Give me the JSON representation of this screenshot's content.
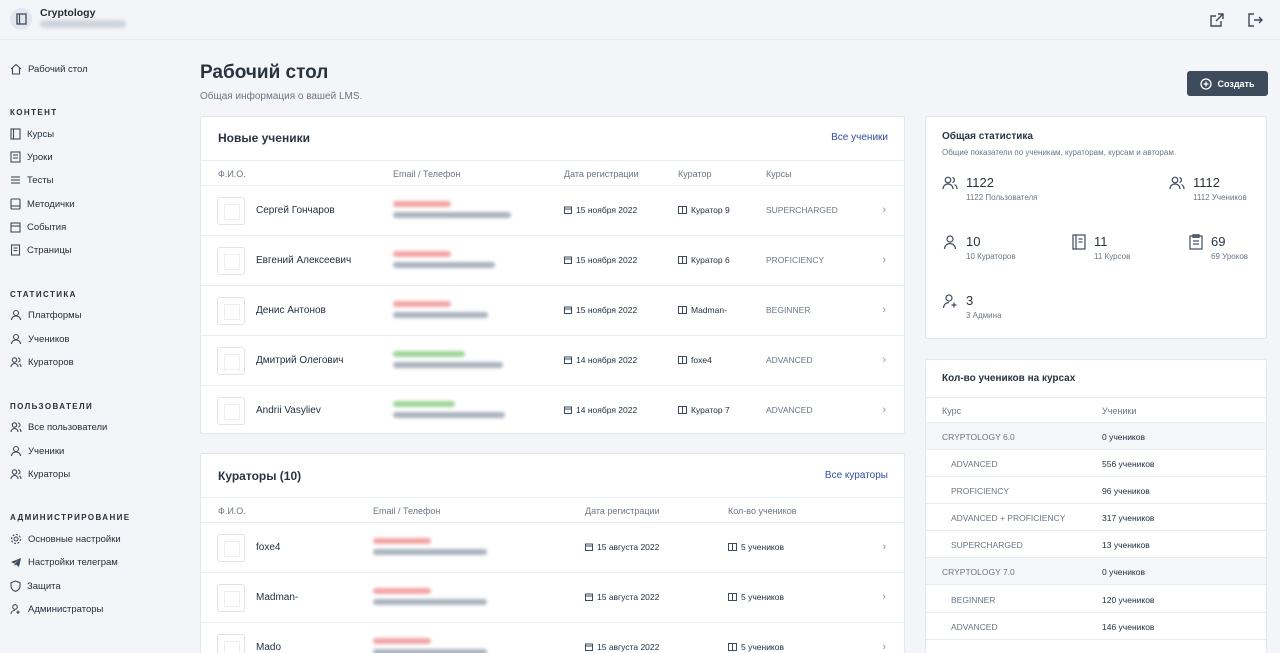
{
  "app": {
    "name": "Cryptology"
  },
  "sidebar": {
    "home": "Рабочий стол",
    "sections": [
      {
        "title": "КОНТЕНТ",
        "items": [
          "Курсы",
          "Уроки",
          "Тесты",
          "Методички",
          "События",
          "Страницы"
        ]
      },
      {
        "title": "СТАТИСТИКА",
        "items": [
          "Платформы",
          "Учеников",
          "Кураторов"
        ]
      },
      {
        "title": "ПОЛЬЗОВАТЕЛИ",
        "items": [
          "Все пользователи",
          "Ученики",
          "Кураторы"
        ]
      },
      {
        "title": "АДМИНИСТРИРОВАНИЕ",
        "items": [
          "Основные настройки",
          "Настройки телеграм",
          "Защита",
          "Администраторы"
        ]
      }
    ]
  },
  "header": {
    "title": "Рабочий стол",
    "subtitle": "Общая информация о вашей LMS.",
    "create_label": "Создать"
  },
  "students": {
    "title": "Новые ученики",
    "link": "Все ученики",
    "columns": [
      "Ф.И.О.",
      "Email / Телефон",
      "Дата регистрации",
      "Куратор",
      "Курсы"
    ],
    "rows": [
      {
        "name": "Сергей Гончаров",
        "date": "15 ноября 2022",
        "curator": "Куратор 9",
        "course": "SUPERCHARGED"
      },
      {
        "name": "Евгений Алексеевич",
        "date": "15 ноября 2022",
        "curator": "Куратор 6",
        "course": "PROFICIENCY"
      },
      {
        "name": "Денис Антонов",
        "date": "15 ноября 2022",
        "curator": "Madman-",
        "course": "BEGINNER"
      },
      {
        "name": "Дмитрий Олегович",
        "date": "14 ноября 2022",
        "curator": "foxe4",
        "course": "ADVANCED"
      },
      {
        "name": "Andrii Vasyliev",
        "date": "14 ноября 2022",
        "curator": "Куратор 7",
        "course": "ADVANCED"
      }
    ]
  },
  "curators": {
    "title": "Кураторы (10)",
    "link": "Все кураторы",
    "columns": [
      "Ф.И.О.",
      "Email / Телефон",
      "Дата регистрации",
      "Кол-во учеников"
    ],
    "rows": [
      {
        "name": "foxe4",
        "date": "15 августа 2022",
        "count": "5 учеников"
      },
      {
        "name": "Madman-",
        "date": "15 августа 2022",
        "count": "5 учеников"
      },
      {
        "name": "Mado",
        "date": "15 августа 2022",
        "count": "5 учеников"
      }
    ]
  },
  "stats": {
    "title": "Общая статистика",
    "subtitle": "Общие показатели по ученикам, кураторам, курсам и авторам.",
    "items": [
      {
        "value": "1122",
        "label": "1122 Пользователя"
      },
      {
        "value": "1112",
        "label": "1112 Учеников"
      },
      {
        "value": "10",
        "label": "10 Кураторов"
      },
      {
        "value": "11",
        "label": "11 Курсов"
      },
      {
        "value": "69",
        "label": "69 Уроков"
      },
      {
        "value": "3",
        "label": "3 Админа"
      }
    ]
  },
  "course_counts": {
    "title": "Кол-во учеников на курсах",
    "columns": [
      "Курс",
      "Ученики"
    ],
    "rows": [
      {
        "course": "CRYPTOLOGY 6.0",
        "count": "0 учеников"
      },
      {
        "course": "ADVANCED",
        "count": "556 учеников"
      },
      {
        "course": "PROFICIENCY",
        "count": "96 учеников"
      },
      {
        "course": "ADVANCED + PROFICIENCY",
        "count": "317 учеников"
      },
      {
        "course": "SUPERCHARGED",
        "count": "13 учеников"
      },
      {
        "course": "CRYPTOLOGY 7.0",
        "count": "0 учеников"
      },
      {
        "course": "BEGINNER",
        "count": "120 учеников"
      },
      {
        "course": "ADVANCED",
        "count": "146 учеников"
      }
    ]
  }
}
